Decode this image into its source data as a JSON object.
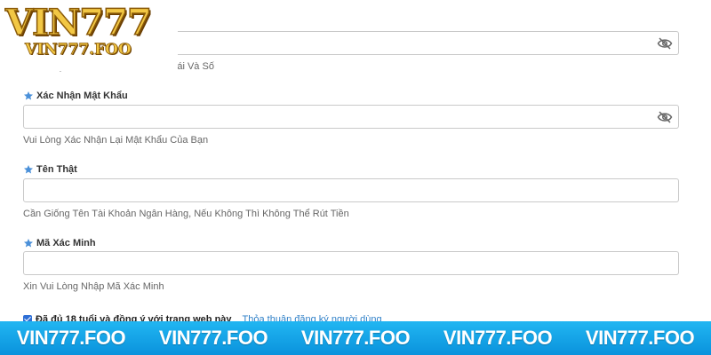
{
  "logo": {
    "brand": "VIN777",
    "domain": "VIN777.FOO"
  },
  "fields": [
    {
      "label": "",
      "hint": "Hơn 6 Ký Tự Phải Bao Gồm Chữ Cái Và Số",
      "value": "",
      "has_eye_icon": true
    },
    {
      "label": "Xác Nhận Mật Khẩu",
      "hint": "Vui Lòng Xác Nhận Lại Mật Khẩu Của Bạn",
      "value": "",
      "has_eye_icon": true
    },
    {
      "label": "Tên Thật",
      "hint": "Cần Giống Tên Tài Khoản Ngân Hàng, Nếu Không Thì Không Thể Rút Tiền",
      "value": "",
      "has_eye_icon": false
    },
    {
      "label": "Mã Xác Minh",
      "hint": "Xin Vui Lòng Nhập Mã Xác Minh",
      "value": "",
      "has_eye_icon": false
    }
  ],
  "agreement": {
    "checked": true,
    "text": "Đã đủ 18 tuổi và đồng ý với trang web này",
    "link": "Thỏa thuận đăng ký người dùng"
  },
  "banner": {
    "items": [
      "VIN777.FOO",
      "VIN777.FOO",
      "VIN777.FOO",
      "VIN777.FOO",
      "VIN777.FOO"
    ]
  },
  "colors": {
    "accent": "#4a90d9",
    "banner": "#1aa8ea",
    "logo_gold": "#f2c744"
  },
  "icons": {
    "field_marker": "star-icon",
    "password_toggle": "eye-slash-icon"
  }
}
